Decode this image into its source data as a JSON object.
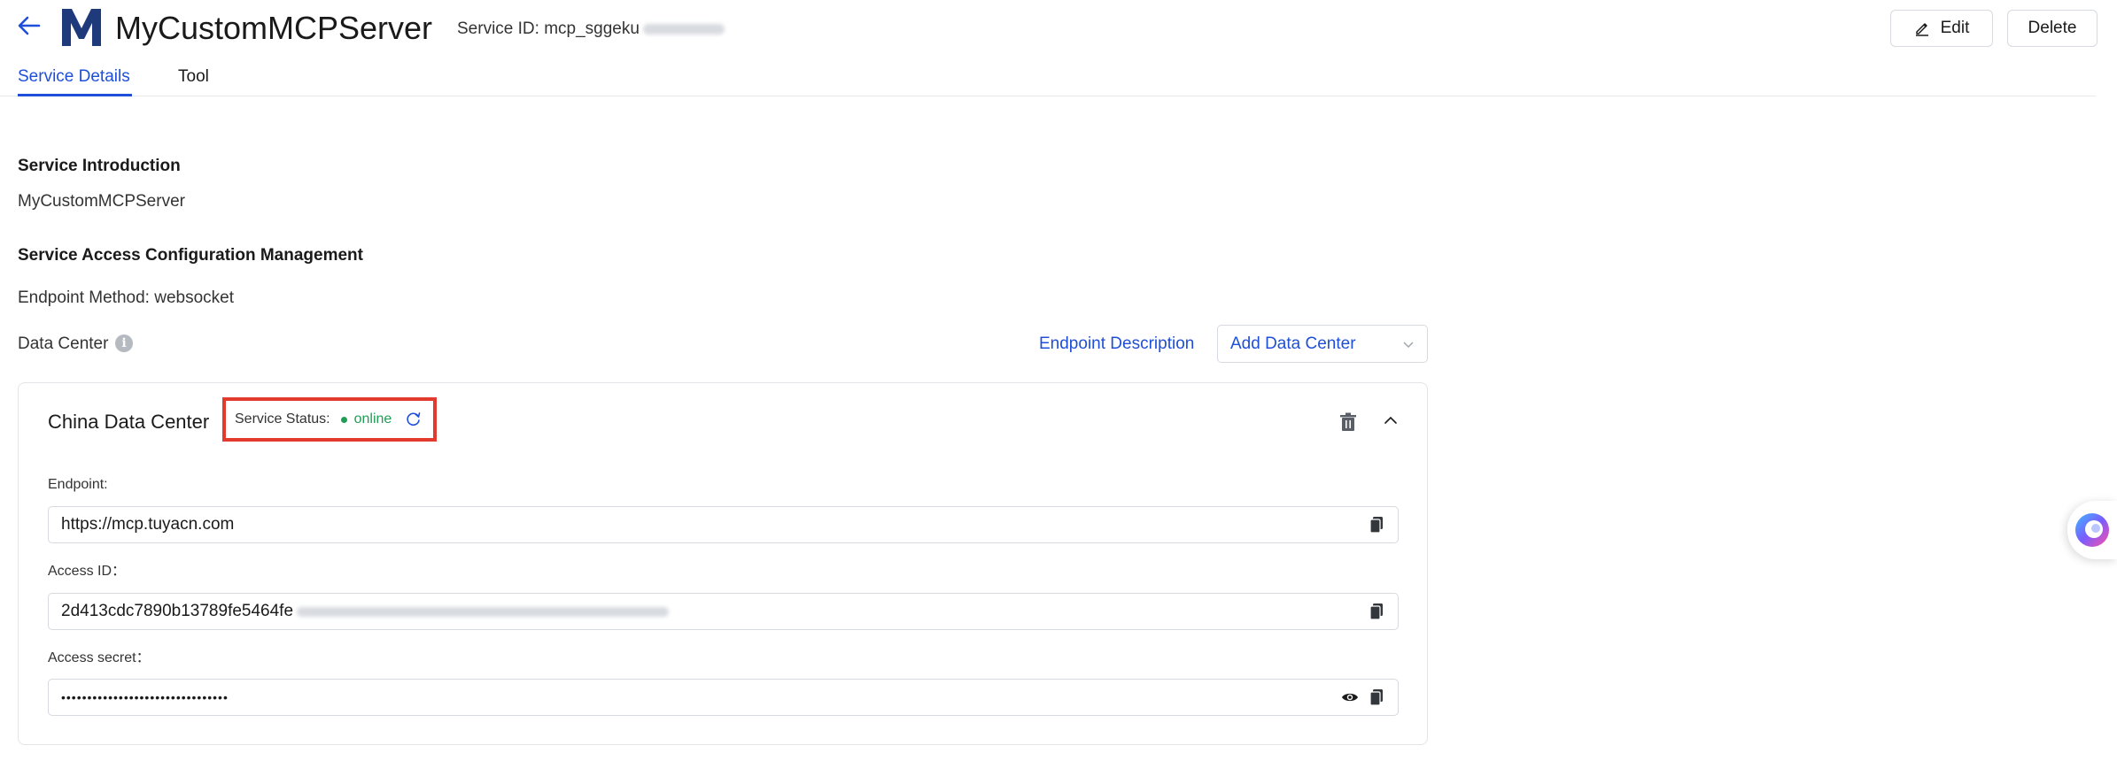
{
  "header": {
    "title": "MyCustomMCPServer",
    "service_id_label": "Service ID: mcp_sggeku",
    "edit_label": "Edit",
    "delete_label": "Delete"
  },
  "tabs": [
    {
      "label": "Service Details",
      "active": true
    },
    {
      "label": "Tool",
      "active": false
    }
  ],
  "details": {
    "intro_heading": "Service Introduction",
    "intro_value": "MyCustomMCPServer",
    "config_heading": "Service Access Configuration Management",
    "endpoint_method": "Endpoint Method: websocket",
    "data_center_label": "Data Center",
    "endpoint_description_link": "Endpoint Description",
    "add_data_center_select": "Add Data Center"
  },
  "card": {
    "title": "China Data Center",
    "status_label": "Service Status:",
    "status_value": "online",
    "endpoint_label": "Endpoint:",
    "endpoint_value": "https://mcp.tuyacn.com",
    "access_id_label": "Access ID：",
    "access_id_value": "2d413cdc7890b13789fe5464fe",
    "access_secret_label": "Access secret：",
    "access_secret_value": "••••••••••••••••••••••••••••••••"
  },
  "colors": {
    "accent": "#1f4fd8",
    "status_online": "#1f9d55",
    "highlight_box": "#e23b2e"
  },
  "icons": [
    "back-arrow-icon",
    "m-logo-icon",
    "edit-pencil-icon",
    "info-icon",
    "chevron-down-icon",
    "refresh-icon",
    "trash-icon",
    "chevron-up-icon",
    "copy-icon",
    "eye-icon",
    "assistant-icon"
  ]
}
